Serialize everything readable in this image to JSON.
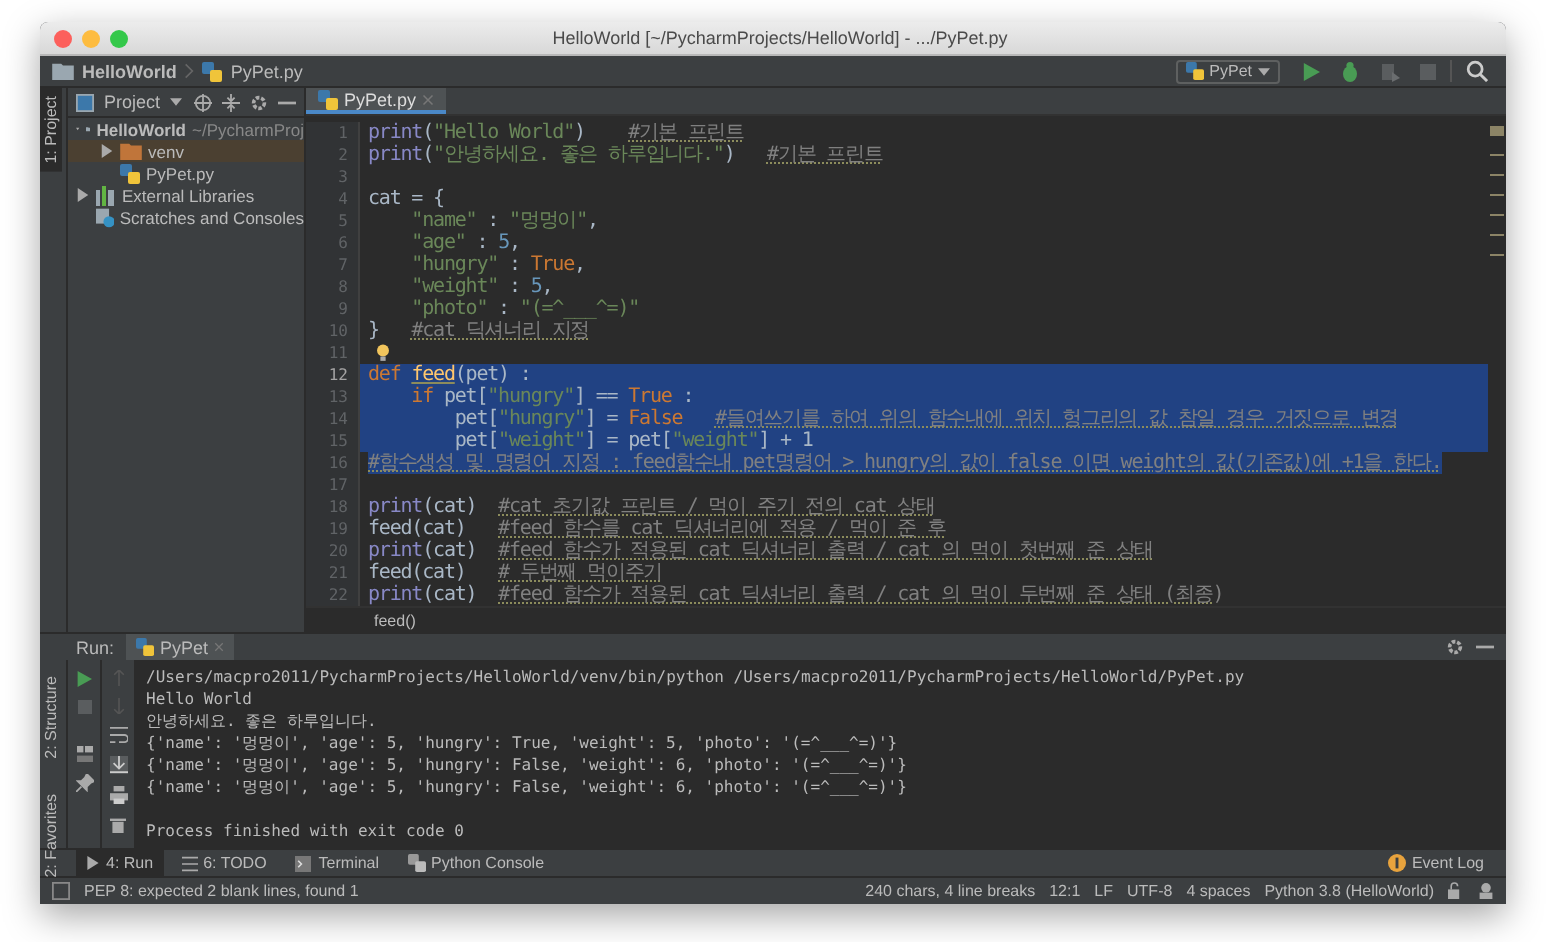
{
  "window": {
    "title": "HelloWorld [~/PycharmProjects/HelloWorld] - .../PyPet.py"
  },
  "navigation": {
    "breadcrumb": [
      "HelloWorld",
      "PyPet.py"
    ],
    "run_config": "PyPet"
  },
  "left_strip": [
    "1: Project"
  ],
  "project": {
    "header": "Project",
    "tree": [
      {
        "label": "HelloWorld",
        "path": "~/PycharmProj",
        "kind": "project",
        "expanded": true,
        "selected": false,
        "children": [
          {
            "label": "venv",
            "kind": "folder",
            "expanded": false,
            "selected": true
          },
          {
            "label": "PyPet.py",
            "kind": "python",
            "selected": false
          }
        ]
      },
      {
        "label": "External Libraries",
        "kind": "library",
        "expanded": false,
        "selected": false
      },
      {
        "label": "Scratches and Consoles",
        "kind": "scratch",
        "selected": false
      }
    ]
  },
  "editor": {
    "tabs": [
      {
        "label": "PyPet.py",
        "selected": true
      }
    ],
    "lines": [
      {
        "n": "1",
        "selected": false,
        "current": false,
        "tokens": [
          {
            "kind": "builtin",
            "text": "print"
          },
          {
            "kind": "plain",
            "text": "("
          },
          {
            "kind": "string",
            "text": "\"Hello World\""
          },
          {
            "kind": "plain",
            "text": ")    "
          },
          {
            "kind": "comment",
            "text": "#기본 프린트"
          }
        ]
      },
      {
        "n": "2",
        "selected": false,
        "current": false,
        "tokens": [
          {
            "kind": "builtin",
            "text": "print"
          },
          {
            "kind": "plain",
            "text": "("
          },
          {
            "kind": "string",
            "text": "\"안녕하세요. 좋은 하루입니다.\""
          },
          {
            "kind": "plain",
            "text": ")   "
          },
          {
            "kind": "comment",
            "text": "#기본 프린트"
          }
        ]
      },
      {
        "n": "3",
        "selected": false,
        "current": false
      },
      {
        "n": "4",
        "selected": false,
        "current": false,
        "tokens": [
          {
            "kind": "plain",
            "text": "cat = {"
          }
        ]
      },
      {
        "n": "5",
        "selected": false,
        "current": false,
        "tokens": [
          {
            "kind": "string",
            "text": "    \"name\""
          },
          {
            "kind": "plain",
            "text": " : "
          },
          {
            "kind": "string",
            "text": "\"멍멍이\""
          },
          {
            "kind": "plain",
            "text": ","
          }
        ]
      },
      {
        "n": "6",
        "selected": false,
        "current": false,
        "tokens": [
          {
            "kind": "string",
            "text": "    \"age\""
          },
          {
            "kind": "plain",
            "text": " : "
          },
          {
            "kind": "number",
            "text": "5"
          },
          {
            "kind": "plain",
            "text": ","
          }
        ]
      },
      {
        "n": "7",
        "selected": false,
        "current": false,
        "tokens": [
          {
            "kind": "string",
            "text": "    \"hungry\""
          },
          {
            "kind": "plain",
            "text": " : "
          },
          {
            "kind": "keyword",
            "text": "True"
          },
          {
            "kind": "plain",
            "text": ","
          }
        ]
      },
      {
        "n": "8",
        "selected": false,
        "current": false,
        "tokens": [
          {
            "kind": "string",
            "text": "    \"weight\""
          },
          {
            "kind": "plain",
            "text": " : "
          },
          {
            "kind": "number",
            "text": "5"
          },
          {
            "kind": "plain",
            "text": ","
          }
        ]
      },
      {
        "n": "9",
        "selected": false,
        "current": false,
        "tokens": [
          {
            "kind": "string",
            "text": "    \"photo\""
          },
          {
            "kind": "plain",
            "text": " : "
          },
          {
            "kind": "string",
            "text": "\"(=^___^=)\""
          }
        ]
      },
      {
        "n": "10",
        "selected": false,
        "current": false,
        "tokens": [
          {
            "kind": "plain",
            "text": "}   "
          },
          {
            "kind": "comment",
            "text": "#cat 딕셔너리 지정"
          }
        ]
      },
      {
        "n": "11",
        "selected": false,
        "current": false,
        "bulb": true
      },
      {
        "n": "12",
        "selected": true,
        "current": true,
        "tokens": [
          {
            "kind": "keyword",
            "text": "def "
          },
          {
            "kind": "func",
            "text": "feed"
          },
          {
            "kind": "plain",
            "text": "(pet) :"
          }
        ]
      },
      {
        "n": "13",
        "selected": true,
        "current": false,
        "tokens": [
          {
            "kind": "keyword",
            "text": "    if "
          },
          {
            "kind": "plain",
            "text": "pet["
          },
          {
            "kind": "string",
            "text": "\"hungry\""
          },
          {
            "kind": "plain",
            "text": "] == "
          },
          {
            "kind": "keyword",
            "text": "True"
          },
          {
            "kind": "plain",
            "text": " :"
          }
        ]
      },
      {
        "n": "14",
        "selected": true,
        "current": false,
        "tokens": [
          {
            "kind": "plain",
            "text": "        pet["
          },
          {
            "kind": "string",
            "text": "\"hungry\""
          },
          {
            "kind": "plain",
            "text": "] = "
          },
          {
            "kind": "keyword",
            "text": "False   "
          },
          {
            "kind": "comment",
            "text": "#들여쓰기를 하여 위의 함수내에 위치 헝그리의 값 참일 경우 거짓으로 변경"
          }
        ]
      },
      {
        "n": "15",
        "selected": true,
        "current": false,
        "tokens": [
          {
            "kind": "plain",
            "text": "        pet["
          },
          {
            "kind": "string",
            "text": "\"weight\""
          },
          {
            "kind": "plain",
            "text": "] = pet["
          },
          {
            "kind": "string",
            "text": "\"weight\""
          },
          {
            "kind": "plain",
            "text": "] + 1"
          }
        ]
      },
      {
        "n": "16",
        "selected": true,
        "current": false,
        "tokens": [
          {
            "kind": "comment",
            "text": "#함수생성 및 명령어 지정 : feed함수내 pet명령어 > hungry의 값이 false 이면 weight의 값(기존값)에 +1을 한다."
          }
        ]
      },
      {
        "n": "17",
        "selected": false,
        "current": false
      },
      {
        "n": "18",
        "selected": false,
        "current": false,
        "tokens": [
          {
            "kind": "builtin",
            "text": "print"
          },
          {
            "kind": "plain",
            "text": "(cat)  "
          },
          {
            "kind": "comment",
            "text": "#cat 초기값 프린트 / 먹이 주기 전의 cat 상태"
          }
        ]
      },
      {
        "n": "19",
        "selected": false,
        "current": false,
        "tokens": [
          {
            "kind": "plain",
            "text": "feed(cat)   "
          },
          {
            "kind": "comment",
            "text": "#feed 함수를 cat 딕셔너리에 적용 / 먹이 준 후"
          }
        ]
      },
      {
        "n": "20",
        "selected": false,
        "current": false,
        "tokens": [
          {
            "kind": "builtin",
            "text": "print"
          },
          {
            "kind": "plain",
            "text": "(cat)  "
          },
          {
            "kind": "comment",
            "text": "#feed 함수가 적용된 cat 딕셔너리 출력 / cat 의 먹이 첫번째 준 상태"
          }
        ]
      },
      {
        "n": "21",
        "selected": false,
        "current": false,
        "tokens": [
          {
            "kind": "plain",
            "text": "feed(cat)   "
          },
          {
            "kind": "comment",
            "text": "# 두번째 먹이주기"
          }
        ]
      },
      {
        "n": "22",
        "selected": false,
        "current": false,
        "tokens": [
          {
            "kind": "builtin",
            "text": "print"
          },
          {
            "kind": "plain",
            "text": "(cat)  "
          },
          {
            "kind": "comment",
            "text": "#feed 함수가 적용된 cat 딕셔너리 출력 / cat 의 먹이 두번째 준 상태 (최종)"
          }
        ]
      }
    ],
    "breadcrumb": "feed()"
  },
  "run_panel": {
    "label": "Run:",
    "tabs": [
      {
        "label": "PyPet",
        "selected": true
      }
    ],
    "side_labels": [
      "2: Structure",
      "2: Favorites"
    ],
    "console": [
      "/Users/macpro2011/PycharmProjects/HelloWorld/venv/bin/python /Users/macpro2011/PycharmProjects/HelloWorld/PyPet.py",
      "Hello World",
      "안녕하세요. 좋은 하루입니다.",
      "{'name': '멍멍이', 'age': 5, 'hungry': True, 'weight': 5, 'photo': '(=^___^=)'}",
      "{'name': '멍멍이', 'age': 5, 'hungry': False, 'weight': 6, 'photo': '(=^___^=)'}",
      "{'name': '멍멍이', 'age': 5, 'hungry': False, 'weight': 6, 'photo': '(=^___^=)'}"
    ],
    "exit_message": "Process finished with exit code 0"
  },
  "tool_tabs": [
    {
      "label": "4: Run",
      "kind": "run",
      "selected": true
    },
    {
      "label": "6: TODO",
      "kind": "todo",
      "selected": false
    },
    {
      "label": "Terminal",
      "kind": "terminal",
      "selected": false
    },
    {
      "label": "Python Console",
      "kind": "console",
      "selected": false
    }
  ],
  "event_log": "Event Log",
  "status_bar": {
    "message": "PEP 8: expected 2 blank lines, found 1",
    "items": [
      "240 chars, 4 line breaks",
      "12:1",
      "LF",
      "UTF-8",
      "4 spaces",
      "Python 3.8 (HelloWorld)"
    ]
  }
}
